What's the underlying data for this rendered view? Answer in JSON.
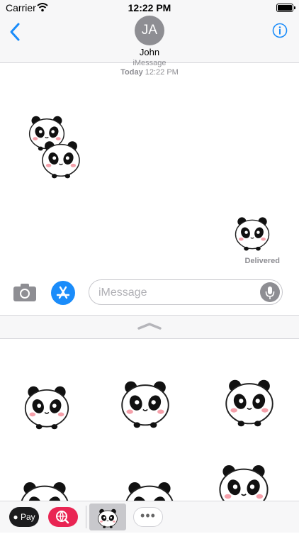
{
  "status_bar": {
    "carrier": "Carrier",
    "time": "12:22 PM"
  },
  "header": {
    "avatar_initials": "JA",
    "contact_name": "John"
  },
  "conversation": {
    "service_label": "iMessage",
    "timestamp_day": "Today",
    "timestamp_time": "12:22 PM",
    "delivered_label": "Delivered"
  },
  "compose": {
    "placeholder": "iMessage"
  },
  "app_strip": {
    "apple_pay_label": "Pay",
    "more_label": "•••"
  },
  "icons": {
    "back": "chevron-left-icon",
    "info": "info-icon",
    "camera": "camera-icon",
    "app_store": "app-store-icon",
    "mic": "microphone-icon",
    "expand": "chevron-up-icon",
    "search_app": "globe-search-icon",
    "sticker_app": "panda-icon"
  },
  "colors": {
    "accent": "#1a8cfa",
    "avatar": "#8e8e93",
    "search_app": "#e92553",
    "blush": "#f5a0aa"
  }
}
